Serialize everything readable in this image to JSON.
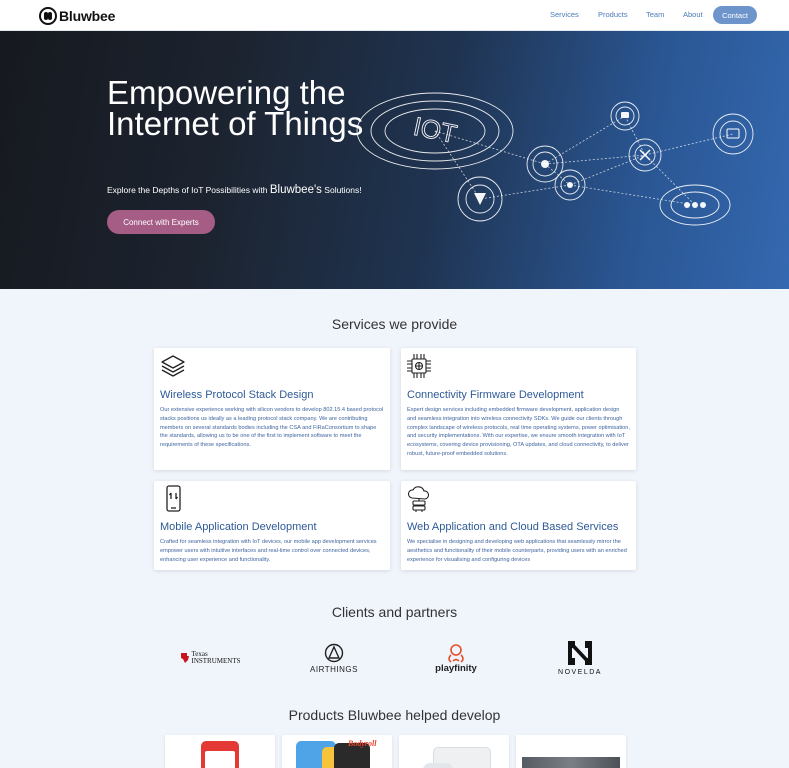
{
  "brand": {
    "name": "Bluwbee"
  },
  "nav": {
    "links": [
      "Services",
      "Products",
      "Team",
      "About"
    ],
    "contact": "Contact"
  },
  "hero": {
    "title": "Empowering the Internet of Things",
    "subtitle_pre": "Explore the Depths of IoT Possibilities with",
    "subtitle_brand": "Bluwbee's",
    "subtitle_post": "Solutions!",
    "cta": "Connect with Experts",
    "art_label": "IOT"
  },
  "services": {
    "heading": "Services we provide",
    "items": [
      {
        "icon": "layers-icon",
        "title": "Wireless Protocol Stack Design",
        "text": "Our extensive experience working with silicon vendors to develop 802.15.4 based protocol stacks positions us ideally as a leading protocol stack company. We are contributing members on several standards bodies including the CSA and FiRaConsortium to shape the standards, allowing us to be one of the first to implement software to meet the requirements of these specifications."
      },
      {
        "icon": "chip-icon",
        "title": "Connectivity Firmware Development",
        "text": "Expert design services including embedded firmware development, application design and seamless integration into wireless connectivity SDKs. We guide our clients through complex landscape of wireless protocols, real time operating systems, power optimisation, and security implementations. With our expertise, we ensure smooth integration with IoT ecosystems, covering device provisioning, OTA updates, and cloud connectivity, to deliver robust, future-proof embedded solutions."
      },
      {
        "icon": "mobile-phone-icon",
        "title": "Mobile Application Development",
        "text": "Crafted for seamless integration with IoT devices, our mobile app development services empower users with intuitive interfaces and real-time control over connected devices, enhancing user experience and functionality."
      },
      {
        "icon": "cloud-icon",
        "title": "Web Application and Cloud Based Services",
        "text": "We specialise in designing and developing web applications that seamlessly mirror the aesthetics and functionality of their mobile counterparts, providing users with an enriched experience for visualising and configuring devices"
      }
    ]
  },
  "partners": {
    "heading": "Clients and partners",
    "items": [
      {
        "line1": "Texas",
        "line2": "Instruments",
        "icon": "texas-instruments-logo"
      },
      {
        "line1": "AIRTHINGS",
        "icon": "airthings-logo"
      },
      {
        "line1": "playfinity",
        "icon": "playfinity-logo"
      },
      {
        "line1": "NOVELDA",
        "icon": "novelda-logo"
      }
    ]
  },
  "products": {
    "heading": "Products Bluwbee helped develop",
    "items": [
      {
        "icon": "phone-app-image"
      },
      {
        "icon": "app-collage-image",
        "badge": "Bodyroll"
      },
      {
        "icon": "device-image"
      },
      {
        "icon": "photo-image"
      }
    ]
  },
  "colors": {
    "accent": "#6e95cb",
    "cta": "#a65d85",
    "link": "#2e5a96",
    "page_bg": "#f0f5fc"
  }
}
